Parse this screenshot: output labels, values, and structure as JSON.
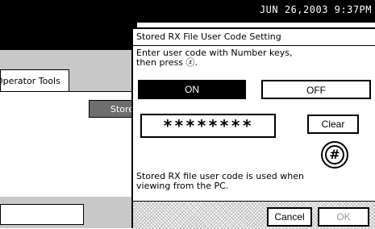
{
  "status_bar": {
    "clock": "JUN  26,2003  9:37PM"
  },
  "background": {
    "tab_label": "Operator Tools",
    "store_button": "Store"
  },
  "dialog": {
    "title": "Stored RX File User Code Setting",
    "instruction_line1": "Enter user code with Number keys,",
    "instruction_line2": "then press ⓩ.",
    "on_label": "ON",
    "off_label": "OFF",
    "code_value": "********",
    "clear_label": "Clear",
    "hash_label": "#",
    "note_line1": "Stored RX file user code is used when",
    "note_line2": "viewing from the PC.",
    "cancel_label": "Cancel",
    "ok_label": "OK"
  }
}
